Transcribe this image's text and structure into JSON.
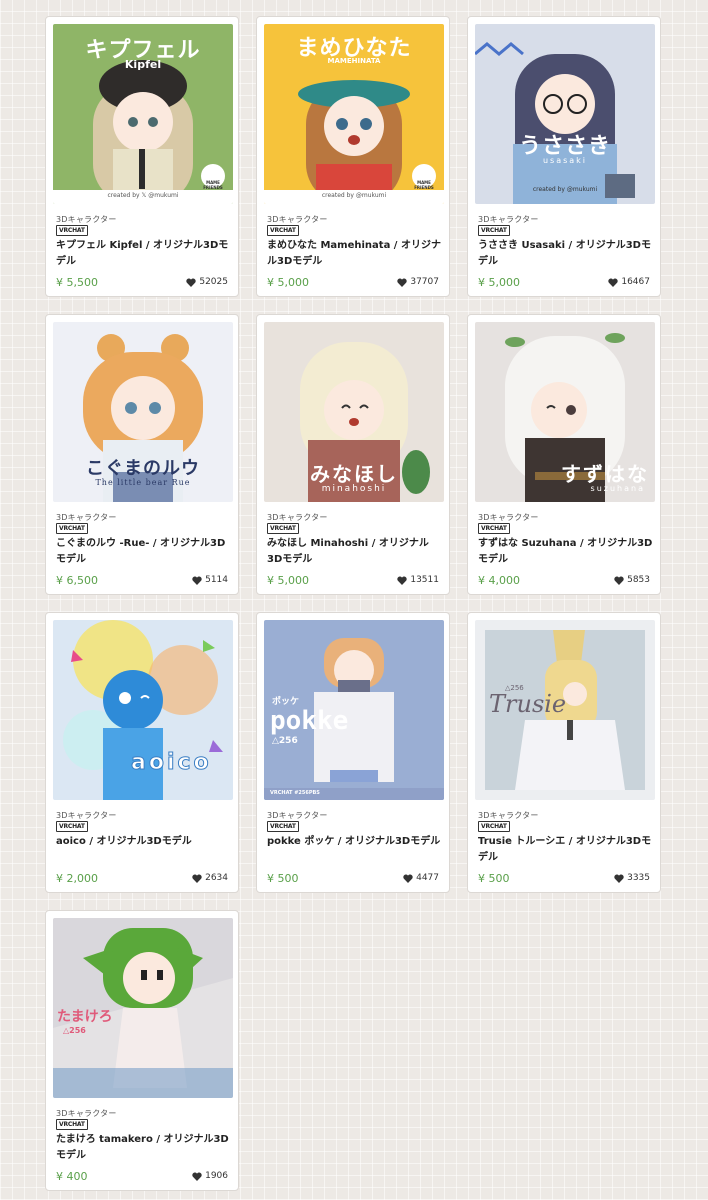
{
  "cards": [
    {
      "category": "3Dキャラクター",
      "platform": "VRCHAT",
      "title": "キプフェル Kipfel / オリジナル3Dモデル",
      "price": "¥ 5,500",
      "likes": "52025",
      "cover": {
        "main": "キプフェル",
        "sub": "Kipfel",
        "credit": "created by 𝕏 @mukumi",
        "badge": "MAME FRIENDS"
      }
    },
    {
      "category": "3Dキャラクター",
      "platform": "VRCHAT",
      "title": "まめひなた Mamehinata / オリジナル3Dモデル",
      "price": "¥ 5,000",
      "likes": "37707",
      "cover": {
        "main": "まめひなた",
        "sub": "MAMEHINATA",
        "credit": "created by @mukumi",
        "badge": "MAME FRIENDS"
      }
    },
    {
      "category": "3Dキャラクター",
      "platform": "VRCHAT",
      "title": "うささき Usasaki / オリジナル3Dモデル",
      "price": "¥ 5,000",
      "likes": "16467",
      "cover": {
        "main": "うささき",
        "sub": "usasaki",
        "credit": "created by @mukumi"
      }
    },
    {
      "category": "3Dキャラクター",
      "platform": "VRCHAT",
      "title": "こぐまのルウ -Rue- / オリジナル3Dモデル",
      "price": "¥ 6,500",
      "likes": "5114",
      "cover": {
        "main": "こぐまのルウ",
        "sub": "The little bear Rue"
      }
    },
    {
      "category": "3Dキャラクター",
      "platform": "VRCHAT",
      "title": "みなほし Minahoshi / オリジナル3Dモデル",
      "price": "¥ 5,000",
      "likes": "13511",
      "cover": {
        "main": "みなほし",
        "sub": "minahoshi"
      }
    },
    {
      "category": "3Dキャラクター",
      "platform": "VRCHAT",
      "title": "すずはな Suzuhana / オリジナル3Dモデル",
      "price": "¥ 4,000",
      "likes": "5853",
      "cover": {
        "main": "すずはな",
        "sub": "suzuhana"
      }
    },
    {
      "category": "3Dキャラクター",
      "platform": "VRCHAT",
      "title": "aoico / オリジナル3Dモデル",
      "price": "¥ 2,000",
      "likes": "2634",
      "cover": {
        "main": "aoico"
      }
    },
    {
      "category": "3Dキャラクター",
      "platform": "VRCHAT",
      "title": "pokke ポッケ / オリジナル3Dモデル",
      "price": "¥ 500",
      "likes": "4477",
      "cover": {
        "main": "pokke",
        "kana": "ポッケ",
        "sub": "△256",
        "credit": "VRCHAT #256PBS"
      }
    },
    {
      "category": "3Dキャラクター",
      "platform": "VRCHAT",
      "title": "Trusie トルーシエ / オリジナル3Dモデル",
      "price": "¥ 500",
      "likes": "3335",
      "cover": {
        "main": "Trusie",
        "sub": "△256"
      }
    },
    {
      "category": "3Dキャラクター",
      "platform": "VRCHAT",
      "title": "たまけろ tamakero / オリジナル3Dモデル",
      "price": "¥ 400",
      "likes": "1906",
      "cover": {
        "main": "たまけろ",
        "sub": "△256"
      }
    }
  ],
  "colors": {
    "price": "#5aa04a",
    "background": "#ede9e5",
    "card": "#ffffff"
  },
  "icons": {
    "likes": "heart-icon"
  }
}
